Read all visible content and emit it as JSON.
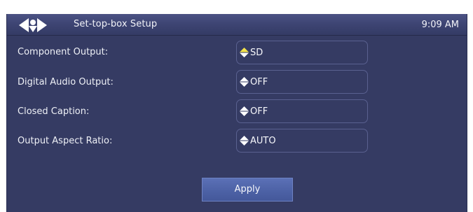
{
  "header": {
    "title": "Set-top-box Setup",
    "time": "9:09 AM",
    "logo_icon": "arrow-badge-logo-icon"
  },
  "settings": [
    {
      "label": "Component Output:",
      "value": "SD",
      "arrow_up_color": "#f3e24a"
    },
    {
      "label": "Digital Audio Output:",
      "value": "OFF",
      "arrow_up_color": "#ffffff"
    },
    {
      "label": "Closed Caption:",
      "value": "OFF",
      "arrow_up_color": "#ffffff"
    },
    {
      "label": "Output Aspect Ratio:",
      "value": "AUTO",
      "arrow_up_color": "#ffffff"
    }
  ],
  "apply_label": "Apply",
  "colors": {
    "panel": "#353b63",
    "titlebar": "#4c5384",
    "button": "#5b70b6",
    "highlight_arrow": "#f3e24a"
  }
}
